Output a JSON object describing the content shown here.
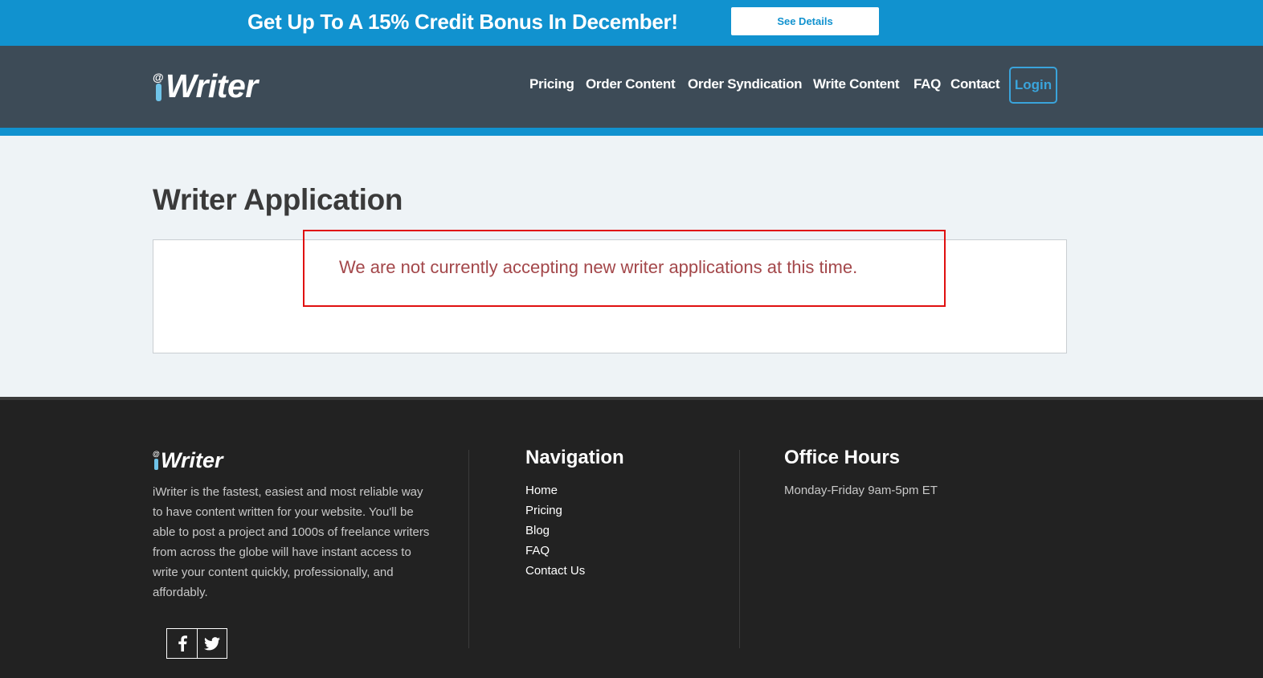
{
  "promo": {
    "text": "Get Up To A 15% Credit Bonus In December!",
    "button_label": "See Details"
  },
  "header": {
    "logo_text": "Writer",
    "logo_at": "@",
    "nav": [
      "Pricing",
      "Order Content",
      "Order Syndication",
      "Write Content",
      "FAQ",
      "Contact"
    ],
    "login_label": "Login"
  },
  "main": {
    "title": "Writer Application",
    "message": "We are not currently accepting new writer applications at this time."
  },
  "footer": {
    "logo_text": "Writer",
    "logo_at": "@",
    "description": "iWriter is the fastest, easiest and most reliable way to have content written for your website. You'll be able to post a project and 1000s of freelance writers from across the globe will have instant access to write your content quickly, professionally, and affordably.",
    "navigation_heading": "Navigation",
    "navigation_links": [
      "Home",
      "Pricing",
      "Blog",
      "FAQ",
      "Contact Us"
    ],
    "hours_heading": "Office Hours",
    "hours_text": "Monday-Friday 9am-5pm ET",
    "social": [
      "facebook-icon",
      "twitter-icon"
    ]
  },
  "colors": {
    "promo_bg": "#1192cf",
    "header_bg": "#3d4b57",
    "accent": "#3aa4db",
    "message": "#a3474a",
    "highlight_border": "#e01010",
    "footer_bg": "#222222"
  }
}
